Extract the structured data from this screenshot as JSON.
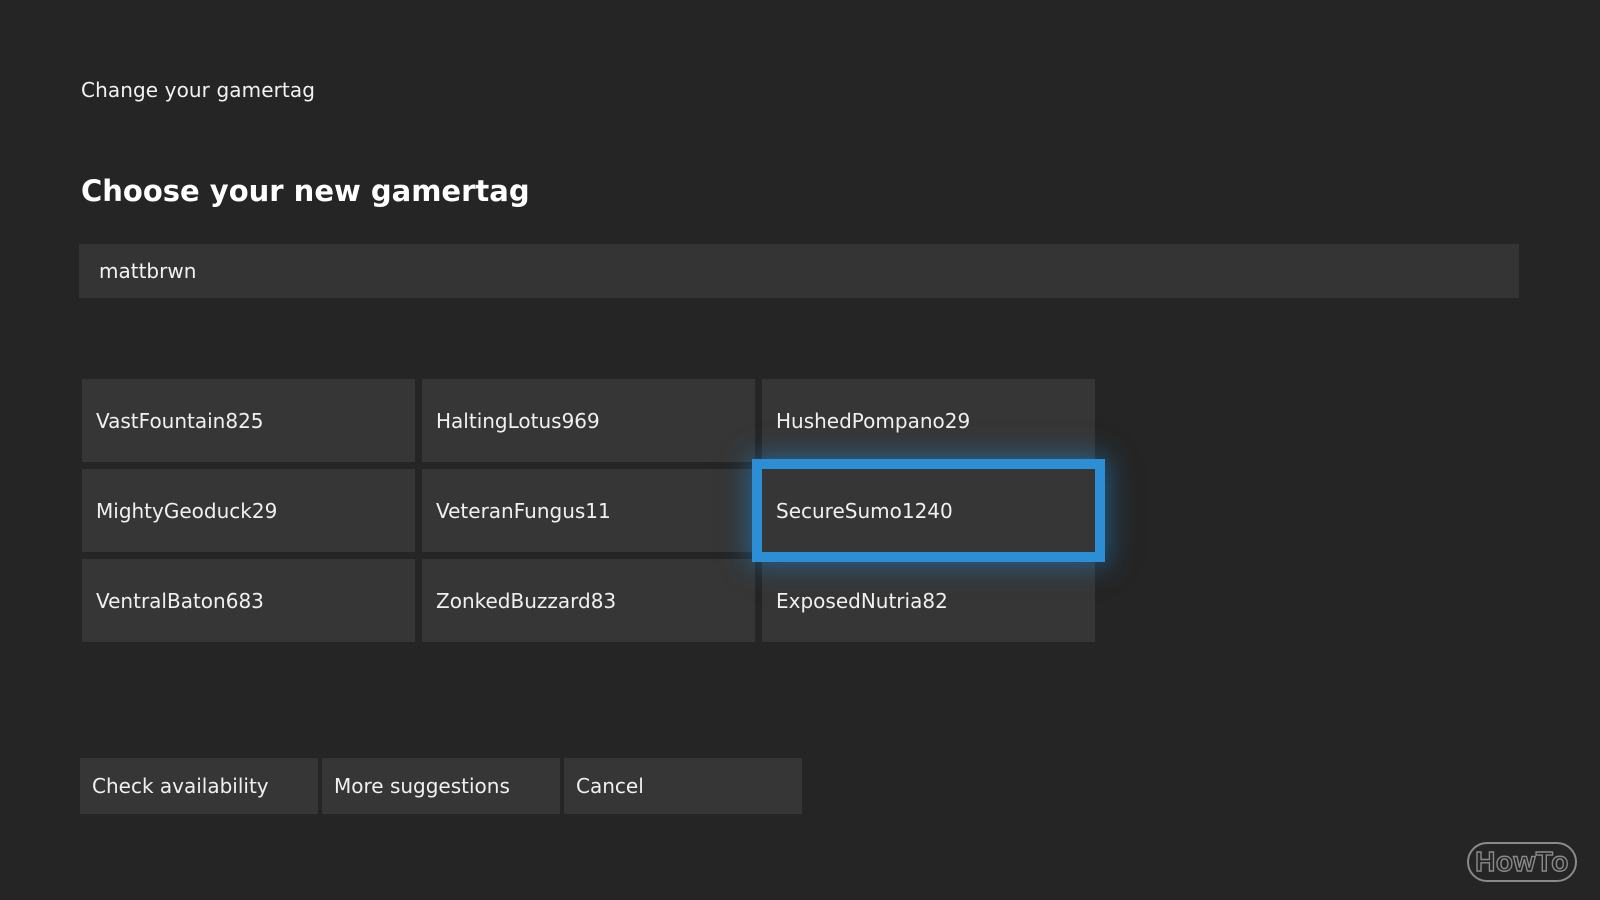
{
  "header": {
    "breadcrumb": "Change your gamertag",
    "title": "Choose your new gamertag"
  },
  "gamertag_input": {
    "value": "mattbrwn"
  },
  "suggestions": [
    {
      "label": "VastFountain825",
      "selected": false
    },
    {
      "label": "HaltingLotus969",
      "selected": false
    },
    {
      "label": "HushedPompano29",
      "selected": false
    },
    {
      "label": "MightyGeoduck29",
      "selected": false
    },
    {
      "label": "VeteranFungus11",
      "selected": false
    },
    {
      "label": "SecureSumo1240",
      "selected": true
    },
    {
      "label": "VentralBaton683",
      "selected": false
    },
    {
      "label": "ZonkedBuzzard83",
      "selected": false
    },
    {
      "label": "ExposedNutria82",
      "selected": false
    }
  ],
  "actions": {
    "check_availability": "Check availability",
    "more_suggestions": "More suggestions",
    "cancel": "Cancel"
  },
  "watermark": {
    "text": "HowTo"
  },
  "colors": {
    "background": "#252525",
    "tile": "#363636",
    "focus_highlight": "#2c8fd6"
  }
}
